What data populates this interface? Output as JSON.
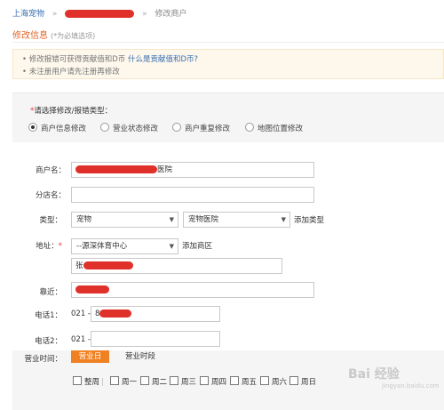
{
  "breadcrumb": {
    "home": "上海宠物",
    "current": "修改商户"
  },
  "page": {
    "title": "修改信息",
    "title_note": "(*为必填选项)"
  },
  "tips": {
    "line1_prefix": "• 修改报错可获得贡献值和D币",
    "line1_link": "什么是贡献值和D币?",
    "line2": "• 未注册用户请先注册再修改"
  },
  "type_select": {
    "required_mark": "*",
    "label": "请选择修改/报错类型：",
    "options": [
      "商户信息修改",
      "营业状态修改",
      "商户重复修改",
      "地图位置修改"
    ],
    "selected_index": 0
  },
  "form": {
    "name_label": "商户名：",
    "name_value_tail": "医院",
    "branch_label": "分店名：",
    "branch_value": "",
    "category_label": "类型：",
    "category_primary": "宠物",
    "category_secondary": "宠物医院",
    "add_category_link": "添加类型",
    "address_label": "地址：",
    "address_required": "*",
    "district_value": "--源深体育中心",
    "add_district_link": "添加商区",
    "address_prefix": "张",
    "nearby_label": "靠近：",
    "phone1_label": "电话1：",
    "phone1_area": "021 -",
    "phone1_number_tail": "8",
    "phone2_label": "电话2：",
    "phone2_area": "021 -",
    "phone2_number": ""
  },
  "hours": {
    "label": "营业时间：",
    "tabs": [
      "营业日",
      "营业时段"
    ],
    "active_tab": 0,
    "days": [
      "整周",
      "周一",
      "周二",
      "周三",
      "周四",
      "周五",
      "周六",
      "周日"
    ]
  },
  "watermark": {
    "text": "Bai 经验",
    "sub": "jingyan.baidu.com"
  },
  "colors": {
    "accent": "#f08122",
    "link": "#3a6fb0",
    "redaction": "#e0302a",
    "title": "#e0652a"
  }
}
